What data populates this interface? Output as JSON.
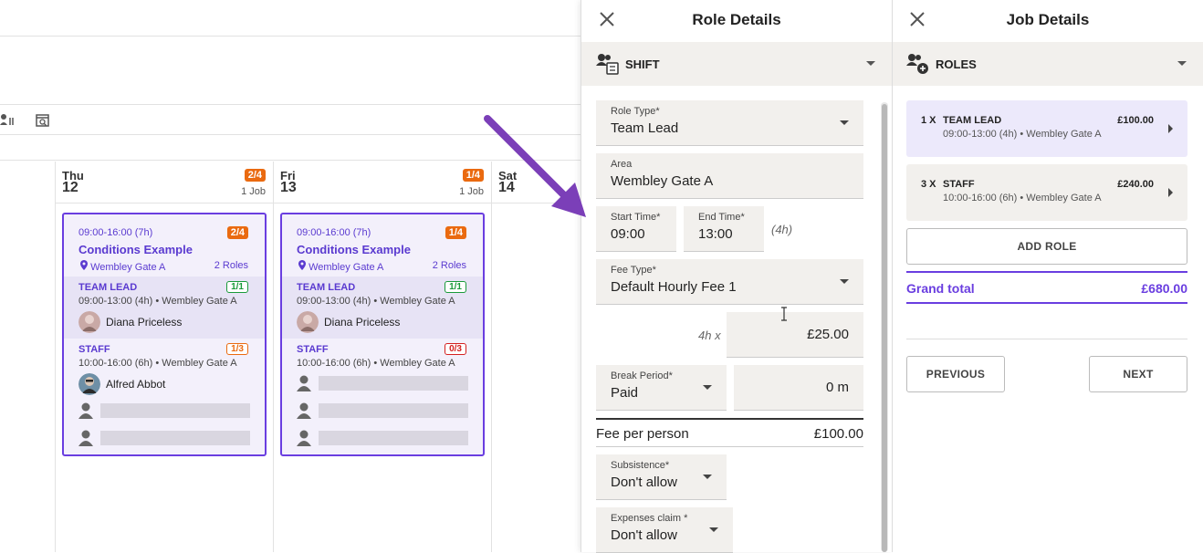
{
  "calendar": {
    "days": [
      {
        "name": "Thu",
        "num": "12",
        "badge": "2/4",
        "jobs": "1 Job"
      },
      {
        "name": "Fri",
        "num": "13",
        "badge": "1/4",
        "jobs": "1 Job"
      },
      {
        "name": "Sat",
        "num": "14"
      }
    ],
    "cards": [
      {
        "time": "09:00-16:00 (7h)",
        "badge": "2/4",
        "title": "Conditions Example",
        "location": "Wembley Gate A",
        "roles": "2 Roles",
        "lead": {
          "name": "TEAM LEAD",
          "fill": "1/1",
          "sub": "09:00-13:00 (4h) • Wembley Gate A",
          "person": "Diana Priceless"
        },
        "staff": {
          "name": "STAFF",
          "fill": "1/3",
          "sub": "10:00-16:00 (6h) • Wembley Gate A",
          "person": "Alfred Abbot"
        }
      },
      {
        "time": "09:00-16:00 (7h)",
        "badge": "1/4",
        "title": "Conditions Example",
        "location": "Wembley Gate A",
        "roles": "2 Roles",
        "lead": {
          "name": "TEAM LEAD",
          "fill": "1/1",
          "sub": "09:00-13:00 (4h) • Wembley Gate A",
          "person": "Diana Priceless"
        },
        "staff": {
          "name": "STAFF",
          "fill": "0/3",
          "sub": "10:00-16:00 (6h) • Wembley Gate A"
        }
      }
    ]
  },
  "role_details": {
    "title": "Role Details",
    "section": "SHIFT",
    "role_type": {
      "label": "Role Type*",
      "value": "Team Lead"
    },
    "area": {
      "label": "Area",
      "value": "Wembley Gate A"
    },
    "start_time": {
      "label": "Start Time*",
      "value": "09:00"
    },
    "end_time": {
      "label": "End Time*",
      "value": "13:00"
    },
    "duration": "(4h)",
    "fee_type": {
      "label": "Fee Type*",
      "value": "Default Hourly Fee 1"
    },
    "rate_prefix": "4h x",
    "rate": "£25.00",
    "break_period": {
      "label": "Break Period*",
      "value": "Paid"
    },
    "break_minutes": "0 m",
    "fee_per_person": {
      "label": "Fee per person",
      "value": "£100.00"
    },
    "subsistence": {
      "label": "Subsistence*",
      "value": "Don't allow"
    },
    "expenses": {
      "label": "Expenses claim *",
      "value": "Don't allow"
    }
  },
  "job_details": {
    "title": "Job Details",
    "section": "ROLES",
    "roles": [
      {
        "qty": "1 X",
        "name": "TEAM LEAD",
        "price": "£100.00",
        "sub": "09:00-13:00 (4h) • Wembley Gate A",
        "bg": "#ece9fb"
      },
      {
        "qty": "3 X",
        "name": "STAFF",
        "price": "£240.00",
        "sub": "10:00-16:00 (6h) • Wembley Gate A",
        "bg": "#f2f0ed"
      }
    ],
    "add_role": "ADD ROLE",
    "grand_total": {
      "label": "Grand total",
      "value": "£680.00"
    },
    "previous": "PREVIOUS",
    "next": "NEXT"
  },
  "colors": {
    "accent": "#6a3ee0",
    "arrow": "#7b3fb8",
    "badge": "#ea6a10"
  }
}
